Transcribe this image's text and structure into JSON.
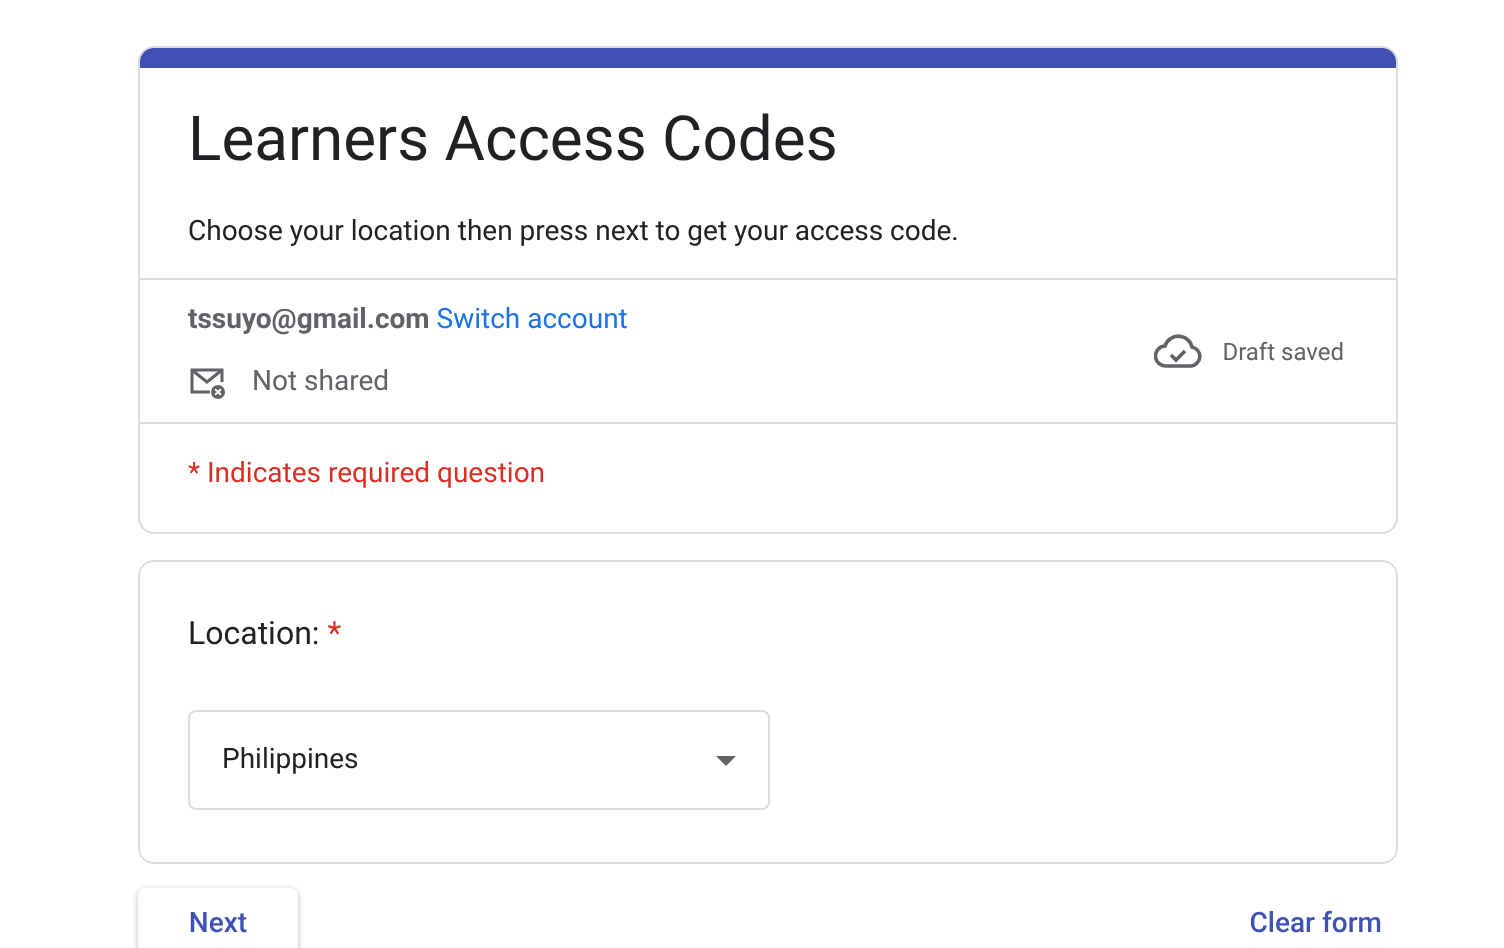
{
  "form": {
    "title": "Learners Access Codes",
    "description": "Choose your location then press next to get your access code.",
    "account": {
      "email": "tssuyo@gmail.com",
      "switch_link": "Switch account",
      "sharing": "Not shared",
      "draft_status": "Draft saved"
    },
    "required_note": "* Indicates required question"
  },
  "questions": [
    {
      "kind": "dropdown",
      "label": "Location:",
      "required_mark": "*",
      "value": "Philippines"
    }
  ],
  "buttons": {
    "next": "Next",
    "clear": "Clear form"
  }
}
